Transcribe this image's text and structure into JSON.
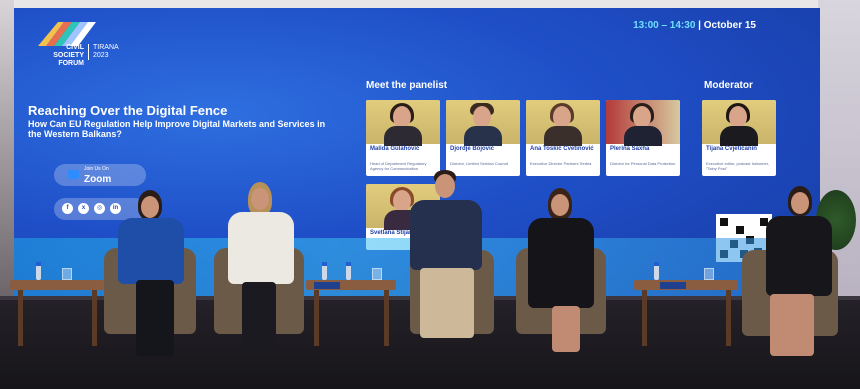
{
  "screen": {
    "logo": {
      "line1": "CIVIL",
      "line2": "SOCIETY",
      "line3": "FORUM",
      "city": "TIRANA",
      "year": "2023"
    },
    "time": {
      "range": "13:00 – 14:30",
      "sep": " | ",
      "date": "October 15"
    },
    "title": "Reaching Over the Digital Fence",
    "subtitle": "How Can EU Regulation Help Improve Digital Markets and Services in the Western Balkans?",
    "zoom": {
      "small": "Join Us On",
      "word": "Zoom"
    },
    "social_icons": [
      "facebook-icon",
      "x-icon",
      "instagram-icon",
      "linkedin-icon"
    ],
    "panelist_heading": "Meet the panelist",
    "moderator_heading": "Moderator",
    "panelists": [
      {
        "name": "Malida Gulahović",
        "role": "Head of Department Regulatory Agency for Communication"
      },
      {
        "name": "Djordje Bojović",
        "role": "Director, Limited Serbian Council"
      },
      {
        "name": "Ana Toskić Cvetinović",
        "role": "Executive Director Partners Serbia"
      },
      {
        "name": "Plerina Saxha",
        "role": "Director for Personal Data Protection"
      },
      {
        "name": "Svetlana Stijanović",
        "role": ""
      }
    ],
    "moderator": {
      "name": "Tijana Cvjetićanin",
      "role": "Executive editor, podcast Istinomer, \"Talny Post\""
    }
  },
  "colors": {
    "screen_blue": "#1f4fc8",
    "accent_cyan": "#6ee0ff",
    "table_wood": "#8a5d41"
  }
}
